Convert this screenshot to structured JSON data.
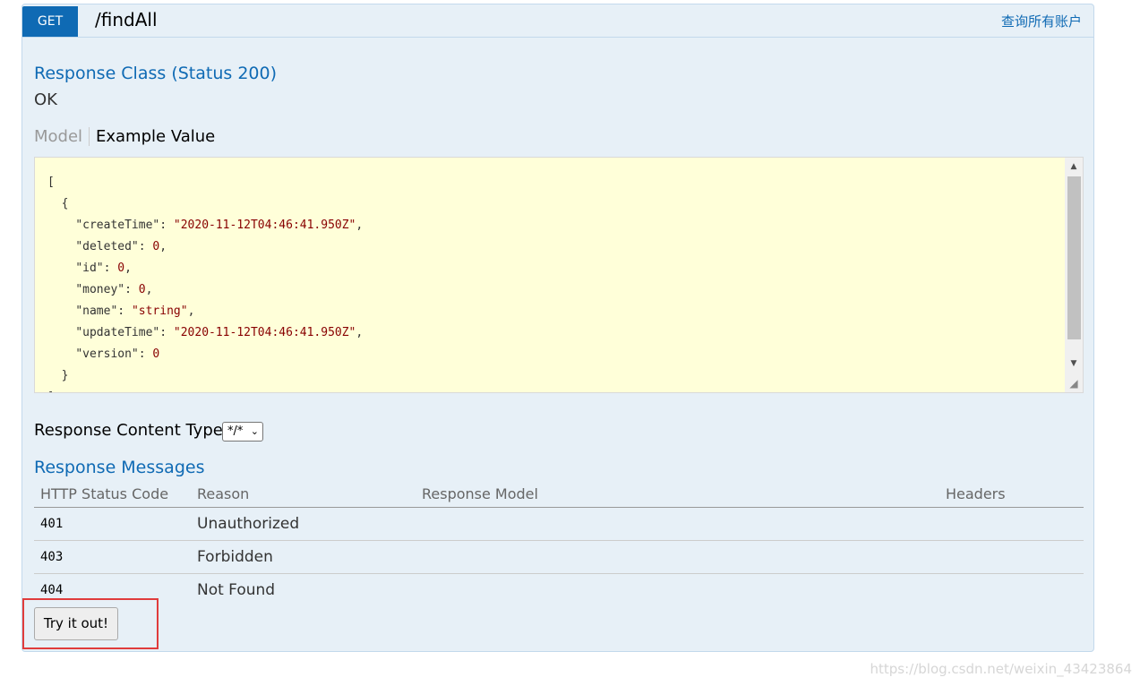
{
  "operation": {
    "method": "GET",
    "path": "/findAll",
    "summary": "查询所有账户"
  },
  "response_class": {
    "title": "Response Class (Status 200)",
    "status_text": "OK"
  },
  "tabs": {
    "model": "Model",
    "example_value": "Example Value"
  },
  "example_value_lines": [
    "[",
    "  {",
    "    \"createTime\": \"2020-11-12T04:46:41.950Z\",",
    "    \"deleted\": 0,",
    "    \"id\": 0,",
    "    \"money\": 0,",
    "    \"name\": \"string\",",
    "    \"updateTime\": \"2020-11-12T04:46:41.950Z\",",
    "    \"version\": 0",
    "  }",
    "]"
  ],
  "response_content_type": {
    "label": "Response Content Type",
    "selected": "*/*"
  },
  "response_messages": {
    "title": "Response Messages",
    "headers": {
      "status_code": "HTTP Status Code",
      "reason": "Reason",
      "model": "Response Model",
      "headers": "Headers"
    },
    "rows": [
      {
        "code": "401",
        "reason": "Unauthorized"
      },
      {
        "code": "403",
        "reason": "Forbidden"
      },
      {
        "code": "404",
        "reason": "Not Found"
      }
    ]
  },
  "try_button": "Try it out!",
  "watermark": "https://blog.csdn.net/weixin_43423864",
  "colors": {
    "method_badge": "#0f6ab4",
    "panel_bg": "#e7f0f7",
    "code_bg": "#ffffd9",
    "highlight": "#e03c3c"
  },
  "icons": {
    "scroll_up": "triangle-up-icon",
    "scroll_down": "triangle-down-icon",
    "resize": "resize-grip-icon",
    "dropdown": "chevron-down-icon"
  }
}
